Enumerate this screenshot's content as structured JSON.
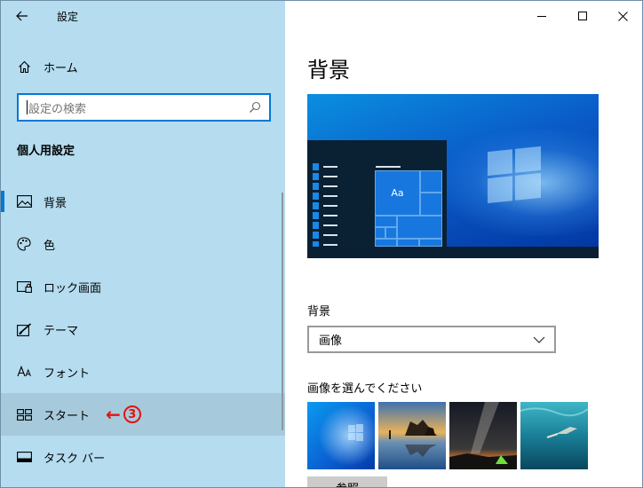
{
  "window": {
    "app_title": "設定",
    "back_icon": "back-arrow-icon",
    "controls": [
      "minimize-icon",
      "maximize-icon",
      "close-icon"
    ]
  },
  "sidebar": {
    "home_label": "ホーム",
    "search": {
      "placeholder": "設定の検索"
    },
    "section_title": "個人用設定",
    "items": [
      {
        "label": "背景",
        "icon": "picture-icon",
        "selected": true
      },
      {
        "label": "色",
        "icon": "palette-icon"
      },
      {
        "label": "ロック画面",
        "icon": "lock-screen-icon"
      },
      {
        "label": "テーマ",
        "icon": "theme-brush-icon"
      },
      {
        "label": "フォント",
        "icon": "font-icon"
      },
      {
        "label": "スタート",
        "icon": "start-tiles-icon",
        "hovered": true
      },
      {
        "label": "タスク バー",
        "icon": "taskbar-icon"
      }
    ],
    "annotation": {
      "arrow": "←",
      "number": "3"
    }
  },
  "main": {
    "page_title": "背景",
    "preview": {
      "tile_label": "Aa"
    },
    "background_label": "背景",
    "background_dropdown_value": "画像",
    "choose_label": "画像を選んでください",
    "thumbnails": [
      "windows-hero-blue",
      "beach-rocks-sunset",
      "milky-way-tent",
      "underwater-swimmer"
    ],
    "browse_label": "参照"
  },
  "colors": {
    "sidebar_bg": "#b5dcef",
    "accent": "#0078d7",
    "annotation": "#e81010"
  }
}
